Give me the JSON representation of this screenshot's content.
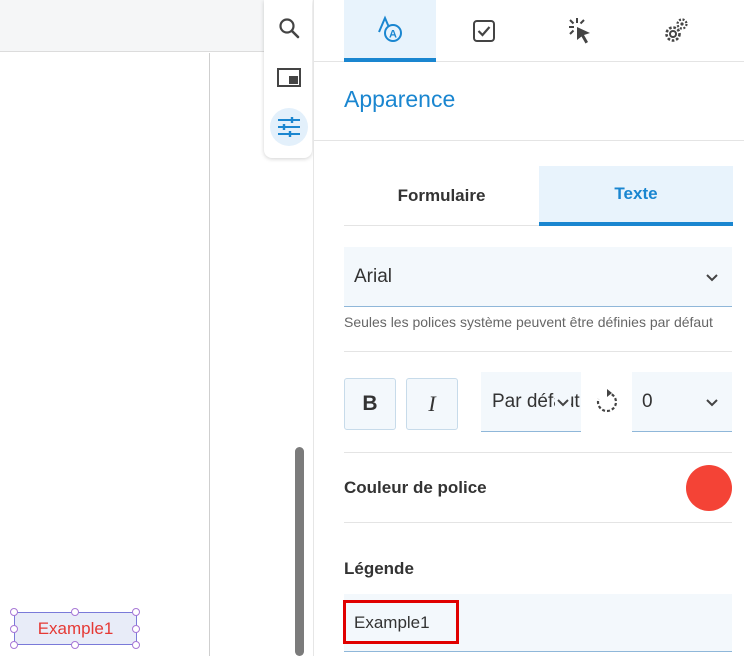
{
  "icons": {
    "search": "search-icon",
    "pip": "picture-in-picture-icon",
    "tune": "sliders-icon",
    "appearance": "text-style-icon",
    "validation": "checkbox-check-icon",
    "actions": "click-cursor-icon",
    "settings": "gears-icon",
    "chevron": "chevron-down-icon",
    "rotate": "rotate-icon"
  },
  "colors": {
    "accent": "#1a86d0",
    "font_color": "#f44336",
    "field_text": "#e53935",
    "highlight": "#e00000"
  },
  "canvas": {
    "field_value": "Example1"
  },
  "panel": {
    "title": "Apparence",
    "subtabs": [
      {
        "label": "Formulaire",
        "active": false
      },
      {
        "label": "Texte",
        "active": true
      }
    ],
    "font": {
      "value": "Arial",
      "hint": "Seules les polices système peuvent être définies par défaut"
    },
    "format": {
      "bold_label": "B",
      "italic_label": "I",
      "size_value": "Par défaut",
      "rotation_value": "0"
    },
    "font_color_label": "Couleur de police",
    "caption": {
      "label": "Légende",
      "value": "Example1"
    }
  }
}
